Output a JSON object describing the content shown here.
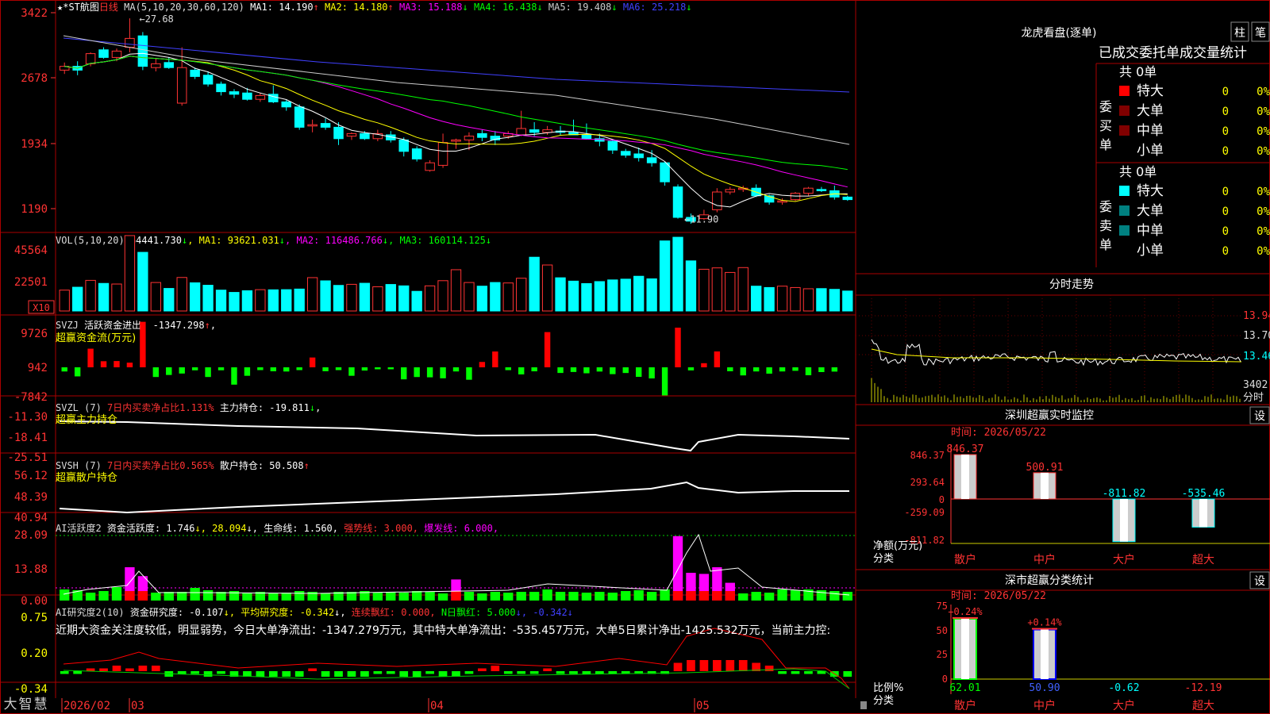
{
  "stock": {
    "name": "★*ST航图",
    "period": "日线"
  },
  "colors": {
    "up": "#ff3333",
    "down": "#00ffff",
    "frame": "#aa0000",
    "ma1": "#ffffff",
    "ma2": "#ffff00",
    "ma3": "#ff00ff",
    "ma4": "#00ff00",
    "ma5": "#cccccc",
    "ma6": "#4040ff"
  },
  "kline": {
    "formula_label": "MA(5,10,20,30,60,120)",
    "ma": [
      {
        "label": "MA1:",
        "value": "14.190",
        "dir": "↑"
      },
      {
        "label": "MA2:",
        "value": "14.180",
        "dir": "↑"
      },
      {
        "label": "MA3:",
        "value": "15.188",
        "dir": "↓"
      },
      {
        "label": "MA4:",
        "value": "16.438",
        "dir": "↓"
      },
      {
        "label": "MA5:",
        "value": "19.408",
        "dir": "↓"
      },
      {
        "label": "MA6:",
        "value": "25.218",
        "dir": "↓"
      }
    ],
    "y_ticks": [
      "3422",
      "2678",
      "1934",
      "1190"
    ],
    "high_mark": "27.68",
    "low_mark": "11.90"
  },
  "chart_data": [
    {
      "type": "candlestick",
      "title": "MA(5,10,20,30,60,120)",
      "y_ticks": [
        "3422",
        "2678",
        "1934",
        "1190"
      ],
      "x_labels": [
        "2026/02",
        "03",
        "04",
        "05"
      ],
      "high": 27.68,
      "low": 11.9,
      "ohlc": [
        [
          23.6,
          24.2,
          23.3,
          23.9
        ],
        [
          23.9,
          24.3,
          23.2,
          23.6
        ],
        [
          24.1,
          25.0,
          23.9,
          24.9
        ],
        [
          25.2,
          25.4,
          24.5,
          24.6
        ],
        [
          24.6,
          25.3,
          24.3,
          25.1
        ],
        [
          25.4,
          27.68,
          25.0,
          26.1
        ],
        [
          26.3,
          26.6,
          23.6,
          23.9
        ],
        [
          23.8,
          24.5,
          23.5,
          24.1
        ],
        [
          24.2,
          24.6,
          23.7,
          23.8
        ],
        [
          21.0,
          25.4,
          20.8,
          23.8
        ],
        [
          23.6,
          23.8,
          22.9,
          23.1
        ],
        [
          23.2,
          23.5,
          22.3,
          22.5
        ],
        [
          22.5,
          22.7,
          21.6,
          21.9
        ],
        [
          21.9,
          22.1,
          21.4,
          21.7
        ],
        [
          21.8,
          22.2,
          21.2,
          21.3
        ],
        [
          21.3,
          21.8,
          21.1,
          21.6
        ],
        [
          21.7,
          22.4,
          21.0,
          21.1
        ],
        [
          21.1,
          21.3,
          20.4,
          20.7
        ],
        [
          20.7,
          20.9,
          18.9,
          19.1
        ],
        [
          19.2,
          19.7,
          18.7,
          19.3
        ],
        [
          19.4,
          19.8,
          18.9,
          19.1
        ],
        [
          19.1,
          19.5,
          17.7,
          18.2
        ],
        [
          18.4,
          18.7,
          18.1,
          18.6
        ],
        [
          18.6,
          18.8,
          18.1,
          18.2
        ],
        [
          18.2,
          18.9,
          18.0,
          18.6
        ],
        [
          18.5,
          18.8,
          17.9,
          18.1
        ],
        [
          18.1,
          18.3,
          16.8,
          17.2
        ],
        [
          17.4,
          17.6,
          16.4,
          16.6
        ],
        [
          15.7,
          16.5,
          15.6,
          16.3
        ],
        [
          16.1,
          18.6,
          15.9,
          17.9
        ],
        [
          18.0,
          18.2,
          17.4,
          18.1
        ],
        [
          18.1,
          18.7,
          17.3,
          18.4
        ],
        [
          18.6,
          18.9,
          18.0,
          18.3
        ],
        [
          18.4,
          18.8,
          17.7,
          18.1
        ],
        [
          18.4,
          18.8,
          18.2,
          18.6
        ],
        [
          18.5,
          20.4,
          18.4,
          19.0
        ],
        [
          18.9,
          19.5,
          18.4,
          18.7
        ],
        [
          18.7,
          19.2,
          18.5,
          18.9
        ],
        [
          18.8,
          19.2,
          18.5,
          18.7
        ],
        [
          18.7,
          19.7,
          18.5,
          18.5
        ],
        [
          18.5,
          19.4,
          18.3,
          18.2
        ],
        [
          18.2,
          18.6,
          17.6,
          18.0
        ],
        [
          18.0,
          18.1,
          17.0,
          17.3
        ],
        [
          17.2,
          17.4,
          16.7,
          16.9
        ],
        [
          17.0,
          17.5,
          16.4,
          16.7
        ],
        [
          16.7,
          17.3,
          16.0,
          16.3
        ],
        [
          16.3,
          16.4,
          14.5,
          14.8
        ],
        [
          14.4,
          14.6,
          11.9,
          12.0
        ],
        [
          12.0,
          12.3,
          11.5,
          11.7
        ],
        [
          11.9,
          12.6,
          11.8,
          12.2
        ],
        [
          12.6,
          14.3,
          12.4,
          14.0
        ],
        [
          14.0,
          14.4,
          13.8,
          14.2
        ],
        [
          14.2,
          14.5,
          14.0,
          14.3
        ],
        [
          14.3,
          14.6,
          13.6,
          13.7
        ],
        [
          13.7,
          13.8,
          13.0,
          13.2
        ],
        [
          13.2,
          13.5,
          13.0,
          13.3
        ],
        [
          13.4,
          14.0,
          13.3,
          13.9
        ],
        [
          13.9,
          14.4,
          13.7,
          14.3
        ],
        [
          14.2,
          14.4,
          14.0,
          14.1
        ],
        [
          14.1,
          14.5,
          13.4,
          13.6
        ],
        [
          13.6,
          13.7,
          13.3,
          13.4
        ]
      ]
    },
    {
      "type": "bar",
      "title": "VOL(5,10,20)",
      "y_ticks": [
        "45564",
        "22501"
      ],
      "values": [
        13700,
        15600,
        20100,
        18100,
        17700,
        49500,
        38500,
        18700,
        14800,
        22000,
        18500,
        16900,
        13700,
        12200,
        13300,
        14000,
        13900,
        14000,
        14400,
        21900,
        19800,
        16800,
        17500,
        18200,
        15900,
        17400,
        16500,
        12900,
        16500,
        19900,
        27100,
        18700,
        16300,
        18700,
        18400,
        21500,
        35300,
        30200,
        21800,
        19600,
        18000,
        19300,
        20400,
        20900,
        22800,
        21100,
        46000,
        48400,
        32900,
        27400,
        28300,
        25300,
        28500,
        16300,
        15400,
        16300,
        15400,
        14600,
        14700,
        14200,
        13100
      ]
    },
    {
      "type": "bar",
      "title": "SVZJ",
      "y_ticks": [
        "9726",
        "942",
        "-7842"
      ],
      "values": [
        -1310,
        -2860,
        5870,
        1920,
        1980,
        1470,
        14340,
        -3050,
        -2410,
        -1960,
        -940,
        -3050,
        -930,
        -5460,
        -2670,
        -880,
        -1250,
        -1320,
        -880,
        3090,
        -1230,
        -880,
        -2670,
        -1020,
        -620,
        -620,
        -3790,
        -3060,
        -3150,
        -3460,
        -1300,
        -3920,
        1690,
        4980,
        -890,
        -2230,
        -1260,
        11100,
        -1780,
        -1470,
        -1880,
        -1330,
        -2150,
        -1790,
        -3000,
        -3500,
        -8860,
        12500,
        -970,
        1300,
        5000,
        -1240,
        -2550,
        -1300,
        -2000,
        -1300,
        -1100,
        -2500,
        -1500,
        -1347.298
      ]
    },
    {
      "type": "line",
      "title": "SVZL (7)",
      "y_ticks": [
        "-11.30",
        "-18.41",
        "-25.51"
      ]
    },
    {
      "type": "line",
      "title": "SVSH (7)",
      "y_ticks": [
        "56.12",
        "48.39",
        "40.94"
      ]
    },
    {
      "type": "bar",
      "title": "AI活跃度2",
      "y_ticks": [
        "28.09",
        "13.88",
        "0.00"
      ]
    },
    {
      "type": "bar",
      "title": "AI研究度2(10)",
      "y_ticks": [
        "0.75",
        "0.20",
        "-0.34"
      ]
    },
    {
      "type": "bar",
      "title": "深圳超赢实时监控",
      "categories": [
        "散户",
        "中户",
        "大户",
        "超大"
      ],
      "values": [
        846.37,
        500.91,
        -811.82,
        -535.46
      ],
      "y_ticks": [
        "846.37",
        "293.64",
        "0",
        "-259.09",
        "-811.82"
      ],
      "ylabel": "净额(万元)"
    },
    {
      "type": "bar",
      "title": "深市超赢分类统计",
      "categories": [
        "散户",
        "中户",
        "大户",
        "超大"
      ],
      "values": [
        62.01,
        50.9,
        -0.62,
        -12.19
      ],
      "changes": [
        "+0.24%",
        "+0.14%",
        "",
        ""
      ],
      "y_ticks": [
        "75",
        "50",
        "25",
        "0"
      ],
      "ylabel": "比例%"
    }
  ],
  "vol": {
    "formula": "VOL(5,10,20)",
    "value": "64441.730",
    "dir": "↓",
    "ma1": "MA1: 93621.031",
    "ma1_dir": "↓",
    "ma2": "MA2: 116486.766",
    "ma2_dir": "↓",
    "ma3": "MA3: 160114.125",
    "ma3_dir": "↓",
    "unit": "X10"
  },
  "svzj": {
    "name": "SVZJ",
    "label": "活跃资金进出:",
    "value": "-1347.298",
    "dir": "↑",
    "sub": "超赢资金流(万元)"
  },
  "svzl": {
    "name": "SVZL (7)",
    "red_text": "7日内买卖净占比1.131%",
    "label": "主力持仓:",
    "value": "-19.811",
    "dir": "↓",
    "sub": "超赢主力持仓"
  },
  "svsh": {
    "name": "SVSH (7)",
    "red_text": "7日内买卖净占比0.565%",
    "label": "散户持仓:",
    "value": "50.508",
    "dir": "↑",
    "sub": "超赢散户持仓"
  },
  "ai_active": {
    "name": "AI活跃度2",
    "label": "资金活跃度:",
    "value": "1.746",
    "v2": "28.094",
    "life_label": "生命线:",
    "life": "1.560",
    "strong": "强势线: 3.000,",
    "burst": "爆发线: 6.000,"
  },
  "ai_research": {
    "name": "AI研究度2(10)",
    "label": "资金研究度:",
    "value": "-0.107",
    "avg": "平均研究度: -0.342",
    "red1": "连续飘红: 0.000,",
    "nred": "N日飘红: 5.000",
    "last": "-0.342",
    "text": "近期大资金关注度较低，明显弱势，今日大单净流出：-1347.279万元，其中特大单净流出：-535.457万元，大单5日累计净出-1425.532万元，当前主力控:"
  },
  "xaxis": [
    "2026/02",
    "03",
    "04",
    "05"
  ],
  "logo": "大智慧",
  "right": {
    "lhkp_title": "龙虎看盘(逐单)",
    "btn_zhu": "柱",
    "btn_bi": "笔",
    "tabs": "已成交委托单成交量统计",
    "buy": {
      "header": "共 0单",
      "vlabel": "委买单",
      "rows": [
        {
          "name": "特大",
          "val": "0",
          "pct": "0%"
        },
        {
          "name": "大单",
          "val": "0",
          "pct": "0%"
        },
        {
          "name": "中单",
          "val": "0",
          "pct": "0%"
        },
        {
          "name": "小单",
          "val": "0",
          "pct": "0%"
        }
      ]
    },
    "sell": {
      "header": "共 0单",
      "vlabel": "委卖单",
      "rows": [
        {
          "name": "特大",
          "val": "0",
          "pct": "0%"
        },
        {
          "name": "大单",
          "val": "0",
          "pct": "0%"
        },
        {
          "name": "中单",
          "val": "0",
          "pct": "0%"
        },
        {
          "name": "小单",
          "val": "0",
          "pct": "0%"
        }
      ]
    },
    "ts_title": "分时走势",
    "ts_ticks": [
      "13.94",
      "13.70",
      "13.46"
    ],
    "ts_vol": "3402",
    "ts_unit": "分时",
    "sz": {
      "title": "深圳超赢实时监控",
      "set": "设",
      "time": "时间: 2026/05/22",
      "ylabel1": "净额(万元)",
      "ylabel2": "分类"
    },
    "ss": {
      "title": "深市超赢分类统计",
      "set": "设",
      "time": "时间: 2026/05/22",
      "ylabel1": "比例%",
      "ylabel2": "分类"
    }
  }
}
